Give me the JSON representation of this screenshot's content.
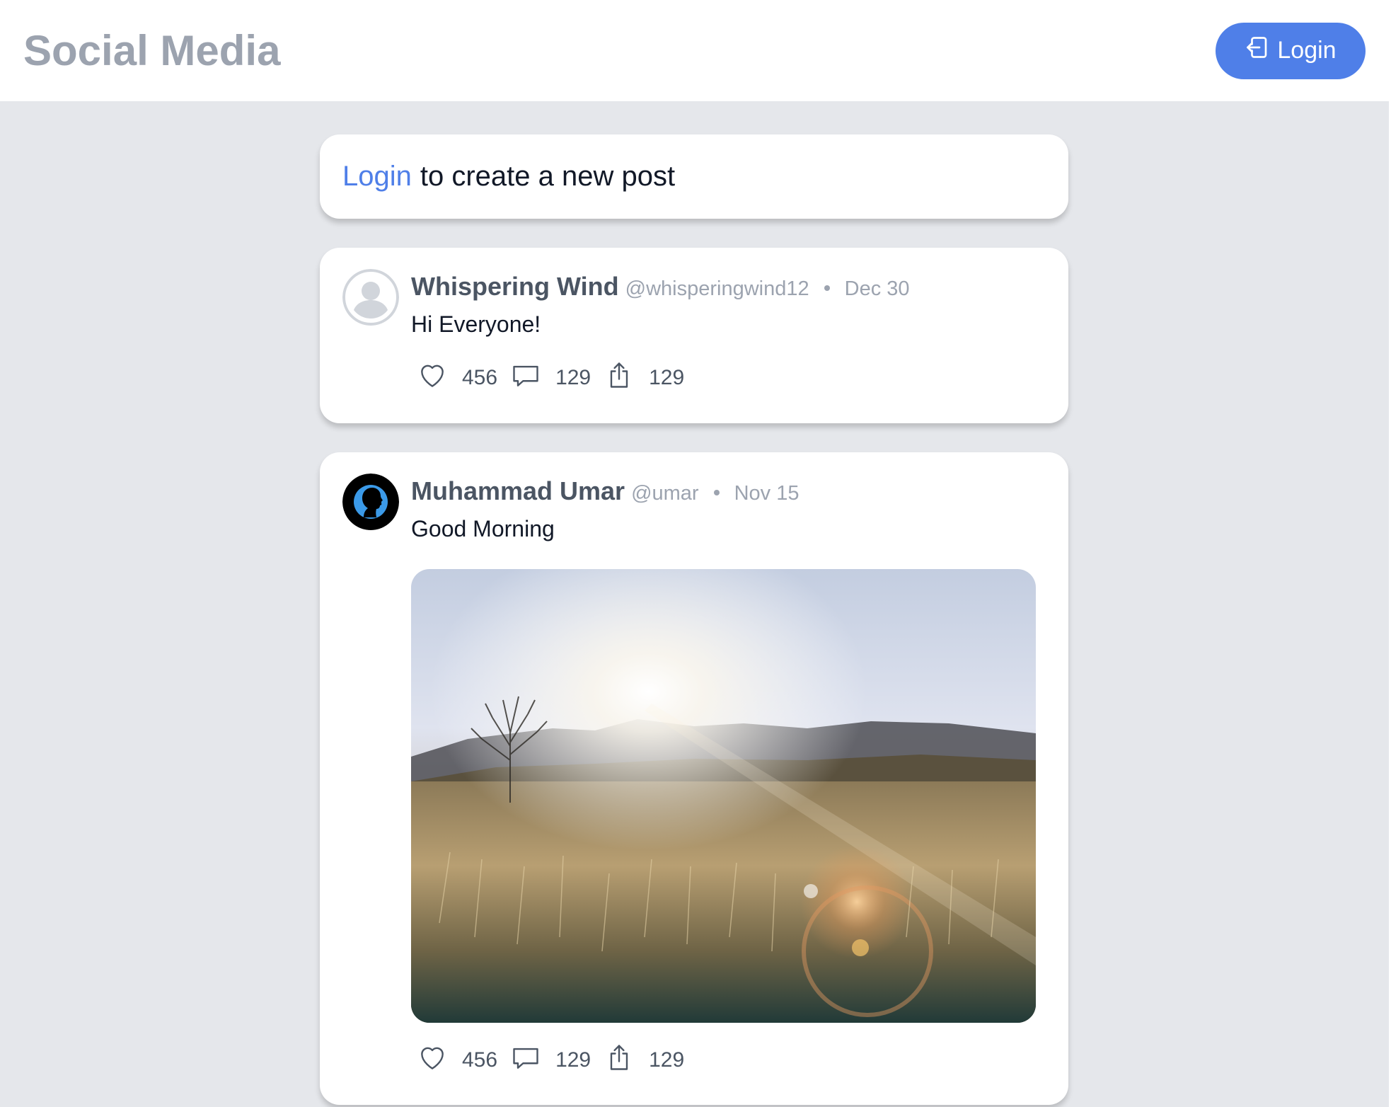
{
  "header": {
    "brand": "Social Media",
    "login_label": "Login"
  },
  "compose": {
    "link_label": "Login",
    "text": "to create a new post"
  },
  "posts": [
    {
      "author": "Whispering Wind",
      "handle": "@whisperingwind12",
      "date": "Dec 30",
      "content": "Hi Everyone!",
      "likes": "456",
      "comments": "129",
      "shares": "129",
      "avatar": "default-user-icon"
    },
    {
      "author": "Muhammad Umar",
      "handle": "@umar",
      "date": "Nov 15",
      "content": "Good Morning",
      "likes": "456",
      "comments": "129",
      "shares": "129",
      "avatar": "silhouette-avatar",
      "image": "sunrise-field-photo"
    }
  ],
  "colors": {
    "accent": "#4f7fe8",
    "background": "#e5e7eb",
    "muted_text": "#9ca3af",
    "author_text": "#4b5563"
  }
}
